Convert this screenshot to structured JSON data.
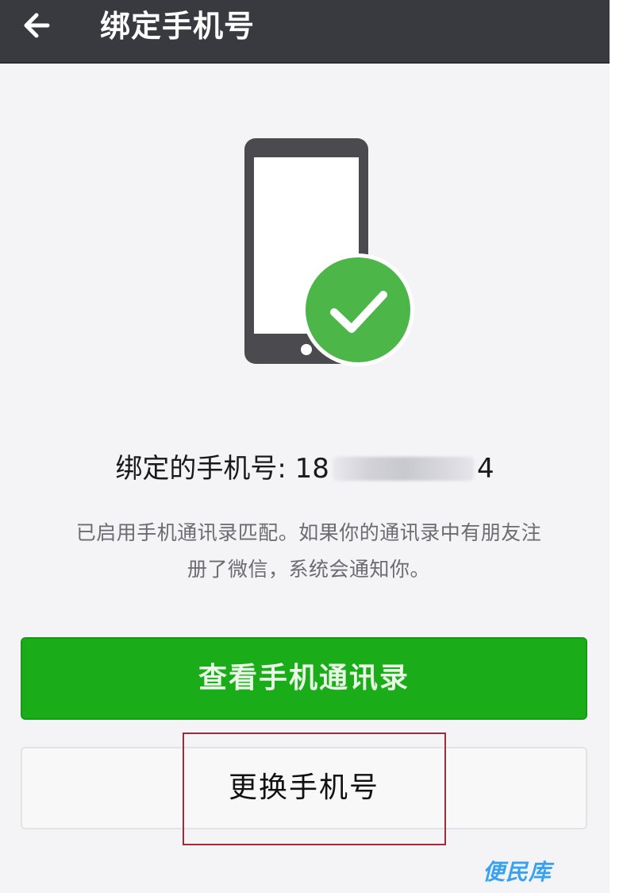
{
  "header": {
    "title": "绑定手机号",
    "back_icon": "arrow-left-icon"
  },
  "illustration": {
    "phone_icon": "smartphone-icon",
    "check_icon": "check-circle-icon",
    "check_color": "#4cb648",
    "phone_color": "#4a4a4f"
  },
  "binding": {
    "label": "绑定的手机号: ",
    "phone_prefix": "18",
    "phone_suffix": "4"
  },
  "hint": {
    "line1": "已启用手机通讯录匹配。如果你的通讯录中有朋友注",
    "line2": "册了微信，系统会通知你。"
  },
  "buttons": {
    "view_contacts": "查看手机通讯录",
    "change_phone": "更换手机号"
  },
  "watermark": {
    "text": "便民库"
  },
  "colors": {
    "app_bar": "#393a3f",
    "primary": "#1aad19",
    "highlight": "#a12a38",
    "watermark": "#39a2f0"
  }
}
